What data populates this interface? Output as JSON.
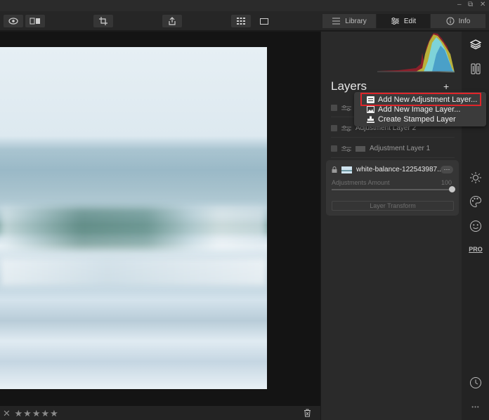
{
  "window": {
    "minimize": "‒",
    "restore": "⧉",
    "close": "✕"
  },
  "toolbar": {
    "tabs": [
      {
        "label": "Library",
        "icon": "library-icon"
      },
      {
        "label": "Edit",
        "icon": "sliders-icon"
      },
      {
        "label": "Info",
        "icon": "info-icon"
      }
    ]
  },
  "layers_panel": {
    "title": "Layers",
    "add_symbol": "+",
    "rows": [
      {
        "label": "Adjustment Layer 2"
      },
      {
        "label": "Adjustment Layer 1"
      }
    ],
    "selected": {
      "name": "white-balance-122543987...",
      "more": "···",
      "amount_label": "Adjustments Amount",
      "amount_value": "100",
      "transform_label": "Layer Transform"
    }
  },
  "menu": {
    "items": [
      {
        "label": "Add New Adjustment Layer...",
        "icon": "adjustment-layer-icon",
        "highlighted": true
      },
      {
        "label": "Add New Image Layer...",
        "icon": "image-layer-icon"
      },
      {
        "label": "Create Stamped Layer",
        "icon": "stamp-icon"
      }
    ]
  },
  "rail": {
    "pro_label": "PRO",
    "more": "•••"
  },
  "bottom": {
    "reject": "✕",
    "stars": "★★★★★",
    "rating": 0
  },
  "colors": {
    "accent_highlight": "#e0252a",
    "panel": "#2a2a2a",
    "toolbar": "#262626"
  }
}
